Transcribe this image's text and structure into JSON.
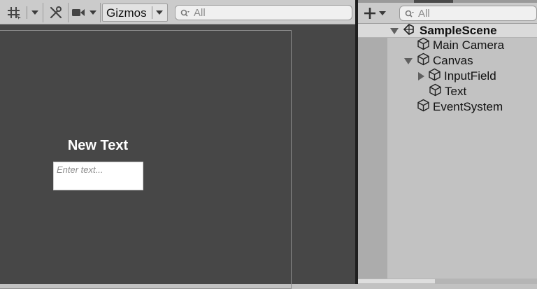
{
  "scene_view": {
    "toolbar": {
      "grid_snap_icon": "grid-snapping-icon",
      "tools_icon": "scene-tools-icon",
      "camera_icon": "scene-camera-icon",
      "gizmos_label": "Gizmos",
      "search_placeholder": "All"
    },
    "canvas": {
      "text_label": "New Text",
      "input_placeholder": "Enter text..."
    }
  },
  "hierarchy": {
    "search_placeholder": "All",
    "add_icon": "plus-icon",
    "scene_name": "SampleScene",
    "items": [
      {
        "label": "Main Camera"
      },
      {
        "label": "Canvas"
      },
      {
        "label": "InputField"
      },
      {
        "label": "Text"
      },
      {
        "label": "EventSystem"
      }
    ]
  },
  "colors": {
    "scene_background": "#474747",
    "panel_background": "#c2c2c2",
    "toolbar_background": "#cbcbcb"
  }
}
